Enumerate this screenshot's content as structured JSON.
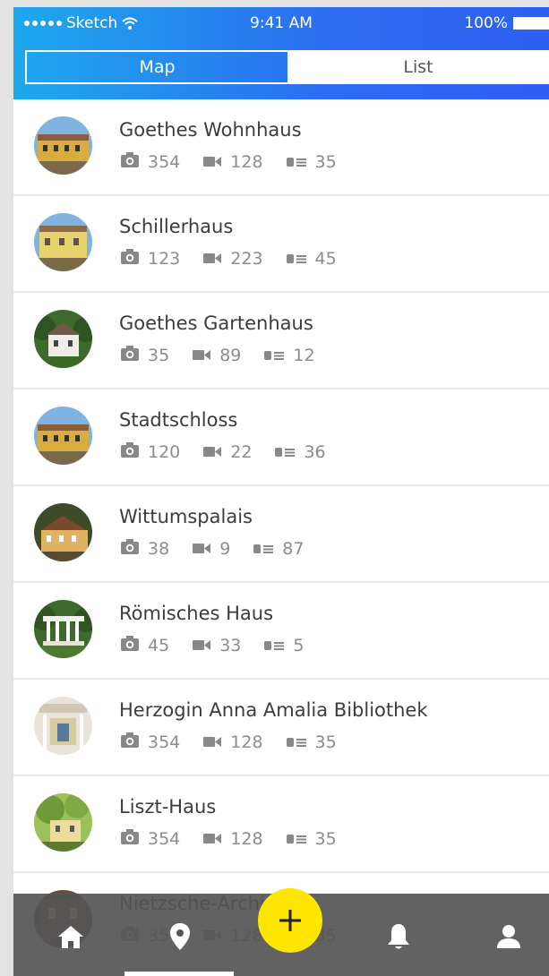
{
  "statusbar": {
    "carrier": "Sketch",
    "time": "9:41 AM",
    "battery": "100%"
  },
  "segmented": {
    "map_label": "Map",
    "list_label": "List",
    "selected": "Map"
  },
  "places": [
    {
      "name": "Goethes Wohnhaus",
      "photos": "354",
      "videos": "128",
      "stories": "35",
      "thumb": "yellow-building"
    },
    {
      "name": "Schillerhaus",
      "photos": "123",
      "videos": "223",
      "stories": "45",
      "thumb": "yellow-house"
    },
    {
      "name": "Goethes Gartenhaus",
      "photos": "35",
      "videos": "89",
      "stories": "12",
      "thumb": "garden-house"
    },
    {
      "name": "Stadtschloss",
      "photos": "120",
      "videos": "22",
      "stories": "36",
      "thumb": "yellow-building"
    },
    {
      "name": "Wittumspalais",
      "photos": "38",
      "videos": "9",
      "stories": "87",
      "thumb": "palace"
    },
    {
      "name": "Römisches Haus",
      "photos": "45",
      "videos": "33",
      "stories": "5",
      "thumb": "temple"
    },
    {
      "name": "Herzogin Anna Amalia Bibliothek",
      "photos": "354",
      "videos": "128",
      "stories": "35",
      "thumb": "library"
    },
    {
      "name": "Liszt-Haus",
      "photos": "354",
      "videos": "128",
      "stories": "35",
      "thumb": "tree-house"
    },
    {
      "name": "Nietzsche-Archiv",
      "photos": "354",
      "videos": "128",
      "stories": "35",
      "thumb": "archive"
    }
  ],
  "tabbar": {
    "tabs": [
      "home-icon",
      "location-pin-icon",
      "add-icon",
      "bell-icon",
      "user-icon"
    ],
    "fab_color": "#ffe600"
  },
  "colors": {
    "header_start": "#1da9ee",
    "header_end": "#2d5ff0",
    "title_text": "#3c3c3c",
    "meta_text": "#8c8c8c"
  }
}
